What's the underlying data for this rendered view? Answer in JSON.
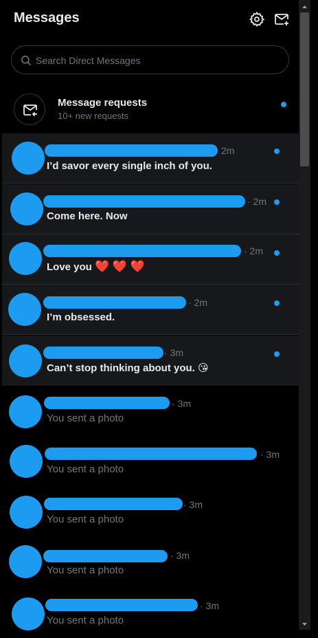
{
  "header": {
    "title": "Messages",
    "settings_icon": "gear-icon",
    "compose_icon": "new-message-icon"
  },
  "search": {
    "placeholder": "Search Direct Messages",
    "icon": "search-icon"
  },
  "requests": {
    "title": "Message requests",
    "subtitle": "10+ new requests",
    "icon": "envelope-arrow-icon"
  },
  "colors": {
    "accent": "#1d9bf0",
    "background": "#000000",
    "unread_bg": "#16181c",
    "muted": "#71767b",
    "text": "#e7e9ea"
  },
  "conversations": [
    {
      "time": "2m",
      "preview": "I’d savor every single inch of you.",
      "unread": true
    },
    {
      "time": "· 2m",
      "preview": "Come here. Now",
      "unread": true
    },
    {
      "time": "· 2m",
      "preview": "Love you",
      "emoji": "❤️ ❤️ ❤️",
      "unread": true
    },
    {
      "time": "· 2m",
      "preview": "I’m obsessed.",
      "unread": true
    },
    {
      "time": "· 3m",
      "preview": "Can’t stop thinking about you.",
      "emoji": "😘",
      "unread": true
    },
    {
      "time": "· 3m",
      "preview": "You sent a photo",
      "unread": false
    },
    {
      "time": "· 3m",
      "preview": "You sent a photo",
      "unread": false
    },
    {
      "time": "· 3m",
      "preview": "You sent a photo",
      "unread": false
    },
    {
      "time": "· 3m",
      "preview": "You sent a photo",
      "unread": false
    },
    {
      "time": "· 3m",
      "preview": "You sent a photo",
      "unread": false
    }
  ]
}
